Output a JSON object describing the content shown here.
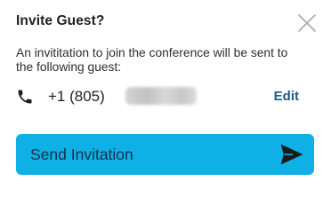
{
  "dialog": {
    "title": "Invite Guest?",
    "message": "An invititation to join the conference will be sent to the following guest:",
    "guest": {
      "phone_visible": "+1 (805)",
      "phone_hidden_note": "",
      "edit_label": "Edit"
    },
    "send_button_label": "Send Invitation",
    "icons": {
      "close": "close-icon",
      "phone": "phone-icon",
      "send": "send-icon"
    },
    "colors": {
      "accent": "#0eb0e6",
      "link": "#1a5a8a",
      "button_text": "#14324a"
    }
  }
}
